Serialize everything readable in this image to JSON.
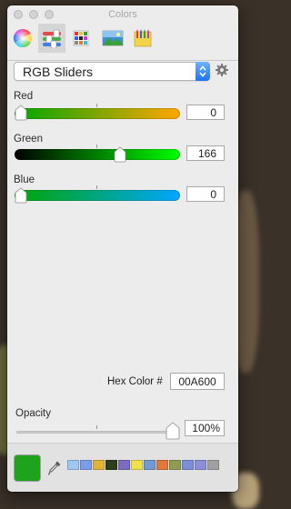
{
  "window": {
    "title": "Colors"
  },
  "mode": {
    "selected": "RGB Sliders"
  },
  "sliders": [
    {
      "label": "Red",
      "value": "0",
      "level": 0,
      "gradient": [
        "#00a600",
        "#ffa600"
      ]
    },
    {
      "label": "Green",
      "value": "166",
      "level": 0.651,
      "gradient": [
        "#000000",
        "#00ff00"
      ]
    },
    {
      "label": "Blue",
      "value": "0",
      "level": 0,
      "gradient": [
        "#00a600",
        "#00a6ff"
      ]
    }
  ],
  "hex": {
    "label": "Hex Color #",
    "value": "00A600"
  },
  "opacity": {
    "label": "Opacity",
    "value": "100%",
    "level": 1.0
  },
  "current_color": "#1fa31c",
  "palette": [
    "#9fc7ef",
    "#7c9dea",
    "#e0b43a",
    "#2a3d1c",
    "#7c6bbf",
    "#f0e24a",
    "#6f9ad6",
    "#e07a3c",
    "#8f9a52",
    "#7b8fd9",
    "#8c8fd8",
    "#a0a0a0"
  ],
  "icons": [
    "close-button-icon",
    "minimize-button-icon",
    "zoom-button-icon",
    "color-wheel-icon",
    "color-sliders-icon",
    "color-palettes-icon",
    "image-palettes-icon",
    "crayons-icon",
    "gear-icon",
    "eyedropper-icon"
  ]
}
